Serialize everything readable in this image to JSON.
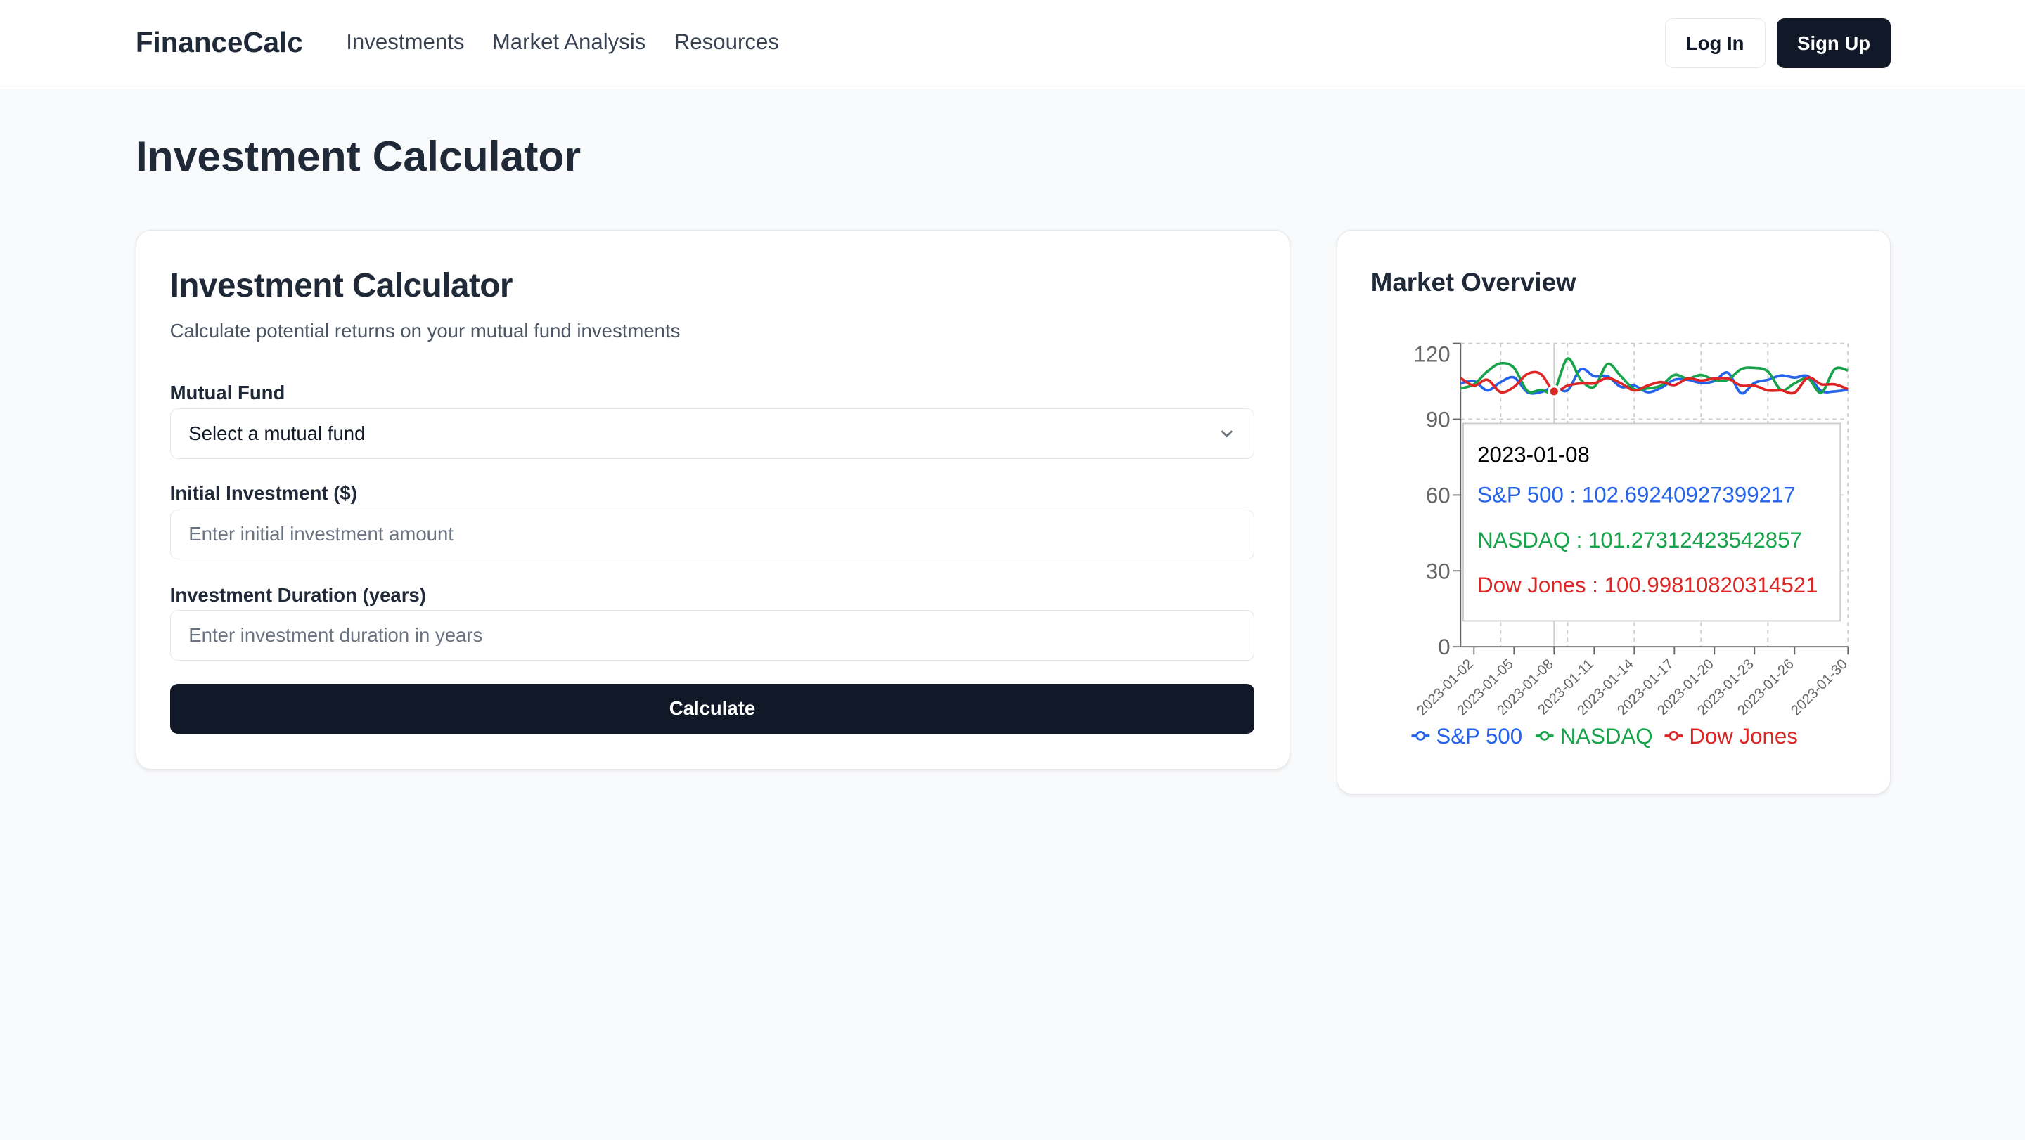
{
  "nav": {
    "logo": "FinanceCalc",
    "links": [
      "Investments",
      "Market Analysis",
      "Resources"
    ],
    "login": "Log In",
    "signup": "Sign Up"
  },
  "page_title": "Investment Calculator",
  "calculator": {
    "title": "Investment Calculator",
    "subtitle": "Calculate potential returns on your mutual fund investments",
    "fund_label": "Mutual Fund",
    "fund_value": "Select a mutual fund",
    "initial_label": "Initial Investment ($)",
    "initial_placeholder": "Enter initial investment amount",
    "duration_label": "Investment Duration (years)",
    "duration_placeholder": "Enter investment duration in years",
    "button": "Calculate"
  },
  "market": {
    "title": "Market Overview",
    "tooltip": {
      "date": "2023-01-08",
      "lines": [
        "S&P 500 : 102.69240927399217",
        "NASDAQ : 101.27312423542857",
        "Dow Jones : 100.99810820314521"
      ]
    }
  },
  "chart_data": {
    "type": "line",
    "x": [
      "2023-01-01",
      "2023-01-02",
      "2023-01-03",
      "2023-01-04",
      "2023-01-05",
      "2023-01-06",
      "2023-01-07",
      "2023-01-08",
      "2023-01-09",
      "2023-01-10",
      "2023-01-11",
      "2023-01-12",
      "2023-01-13",
      "2023-01-14",
      "2023-01-15",
      "2023-01-16",
      "2023-01-17",
      "2023-01-18",
      "2023-01-19",
      "2023-01-20",
      "2023-01-21",
      "2023-01-22",
      "2023-01-23",
      "2023-01-24",
      "2023-01-25",
      "2023-01-26",
      "2023-01-27",
      "2023-01-28",
      "2023-01-29",
      "2023-01-30"
    ],
    "xticks": [
      "2023-01-02",
      "2023-01-05",
      "2023-01-08",
      "2023-01-11",
      "2023-01-14",
      "2023-01-17",
      "2023-01-20",
      "2023-01-23",
      "2023-01-26",
      "2023-01-30"
    ],
    "yticks": [
      0,
      30,
      60,
      90,
      120
    ],
    "ylim": [
      0,
      120
    ],
    "grid": true,
    "legend": "bottom",
    "active_index": 7,
    "series": [
      {
        "name": "S&P 500",
        "color": "#2563eb",
        "values": [
          104.2,
          105.1,
          101.4,
          104.7,
          106.5,
          100.7,
          100.7,
          102.69,
          101.4,
          109.8,
          107,
          107,
          102.8,
          103.3,
          100.7,
          102.4,
          105.6,
          105.6,
          104.4,
          105.1,
          108.4,
          100.3,
          104.4,
          105.6,
          107.3,
          106.5,
          107,
          101.2,
          101,
          101.6
        ]
      },
      {
        "name": "NASDAQ",
        "color": "#16a34a",
        "values": [
          102.2,
          103.8,
          108.9,
          112.1,
          110.3,
          101.2,
          101.6,
          101.27,
          114,
          105.6,
          102.8,
          111.8,
          107,
          101.9,
          102.2,
          103.3,
          107.5,
          106.1,
          107.5,
          105.6,
          105.6,
          109.8,
          110.3,
          108.9,
          101.6,
          104.2,
          106.1,
          100.5,
          109.8,
          109.3
        ]
      },
      {
        "name": "Dow Jones",
        "color": "#dc2626",
        "values": [
          106.3,
          103.3,
          105.6,
          100.7,
          102.8,
          107.9,
          107.9,
          101.0,
          103.3,
          104.2,
          104.2,
          106.3,
          104.2,
          101.4,
          103.3,
          104.7,
          103.5,
          106.1,
          105.3,
          106.1,
          106.1,
          103.3,
          103.3,
          101.4,
          101.4,
          100.5,
          106.5,
          103.8,
          103.8,
          101.9
        ]
      }
    ]
  }
}
